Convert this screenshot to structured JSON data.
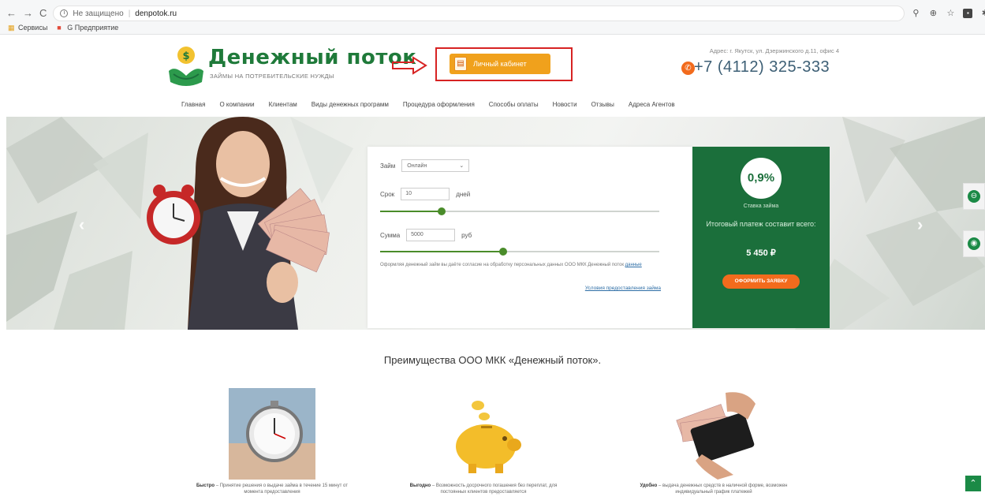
{
  "browser": {
    "nav_back": "←",
    "nav_forward": "→",
    "nav_reload": "C",
    "url_security": "Не защищено",
    "url_host": "denpotok.ru",
    "toolbar_icons": [
      "zoom-icon",
      "translate-icon",
      "star-icon",
      "extension-icon",
      "puzzle-icon",
      "profile-icon"
    ],
    "bookmarks": [
      {
        "label": "Сервисы",
        "icon": "apps-icon"
      },
      {
        "label": "G Предприятие",
        "icon": "bookmark-icon"
      }
    ]
  },
  "header": {
    "logo_title": "Денежный поток",
    "logo_subtitle": "ЗАЙМЫ НА ПОТРЕБИТЕЛЬСКИЕ НУЖДЫ",
    "loan_button": "Личный кабинет",
    "address": "Адрес: г. Якутск, ул. Дзержинского д.11, офис 4",
    "phone": "+7 (4112) 325-333",
    "colors": {
      "brand_green": "#1f7a3a",
      "accent_orange": "#f0a11c",
      "highlight_red": "#d72323"
    }
  },
  "nav": {
    "items": [
      "Главная",
      "О компании",
      "Клиентам",
      "Виды денежных программ",
      "Процедура оформления",
      "Способы оплаты",
      "Новости",
      "Отзывы",
      "Адреса Агентов"
    ]
  },
  "calculator": {
    "loan_label": "Займ",
    "loan_type": "Онлайн",
    "term_label": "Срок",
    "term_value": "10",
    "term_unit": "дней",
    "term_slider": 0.22,
    "amount_label": "Сумма",
    "amount_value": "5000",
    "amount_unit": "руб",
    "amount_slider": 0.44,
    "note": "Оформляя денежный займ вы даёте согласие на обработку персональных данных ООО МКК Денежный поток",
    "note_link": "данные",
    "conditions_link": "Условия предоставления займа"
  },
  "rate_panel": {
    "rate": "0,9%",
    "rate_label": "Ставка займа",
    "total_label": "Итоговый платеж составит всего:",
    "total": "5 450 ₽",
    "apply_button": "ОФОРМИТЬ ЗАЯВКУ"
  },
  "advantages": {
    "title": "Преимущества ООО МКК «Денежный поток».",
    "items": [
      {
        "title": "Быстро",
        "text": " – Принятие решения о выдаче займа в течение 15 минут от момента предоставления"
      },
      {
        "title": "Выгодно",
        "text": " – Возможность досрочного погашения без переплат, для постоянных клиентов предоставляется"
      },
      {
        "title": "Удобно",
        "text": " – выдача денежных средств в наличной форме, возможен индивидуальный график платежей"
      }
    ]
  }
}
